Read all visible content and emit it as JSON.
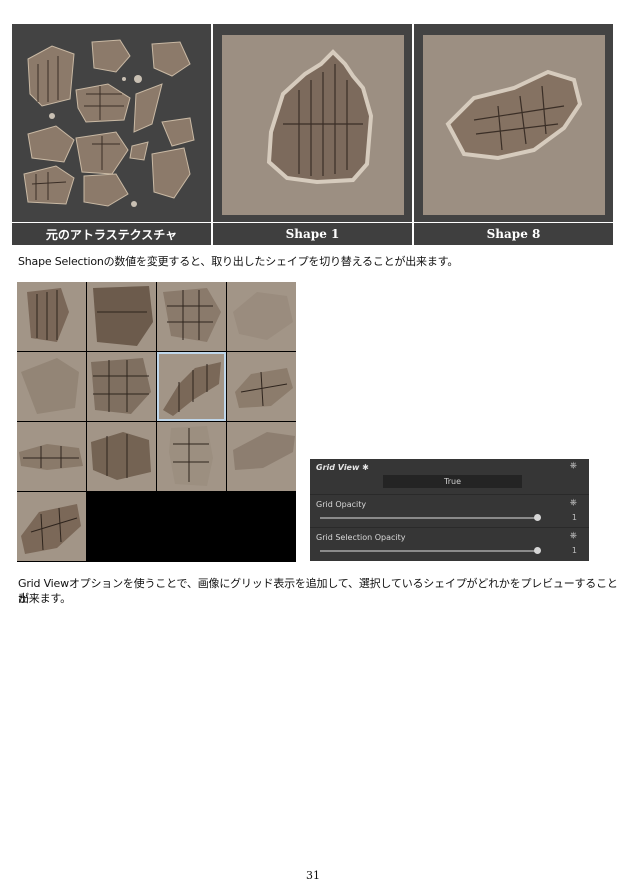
{
  "comparison": {
    "captions": [
      "元のアトラステクスチャ",
      "Shape 1",
      "Shape 8"
    ]
  },
  "caption_1": "Shape Selectionの数値を変更すると、取り出したシェイプを切り替えることが出来ます。",
  "grid_view_panel": {
    "title": "Grid View",
    "toggle_value": "True",
    "rows": [
      {
        "label": "Grid Opacity",
        "value": "1"
      },
      {
        "label": "Grid Selection Opacity",
        "value": "1"
      }
    ]
  },
  "caption_2_line1": "Grid Viewオプションを使うことで、画像にグリッド表示を追加して、選択しているシェイプがどれかをプレビューすることが",
  "caption_2_line2": "出来ます。",
  "page_number": "31"
}
